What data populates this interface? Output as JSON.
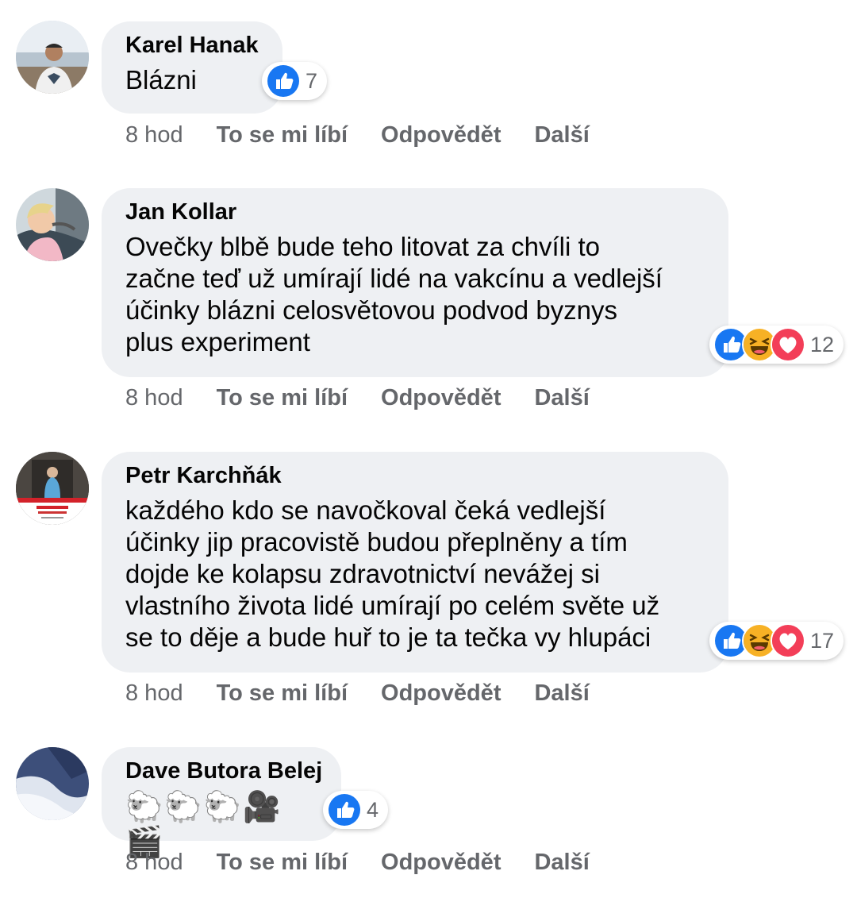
{
  "actions": {
    "like": "To se mi líbí",
    "reply": "Odpovědět",
    "more": "Další"
  },
  "colors": {
    "bubble": "#eef0f3",
    "secondary_text": "#65676b",
    "like_blue": "#1877f2",
    "haha_yellow": "#f7b125",
    "love_red": "#f33e58"
  },
  "comments": [
    {
      "author": "Karel Hanak",
      "text_lines": [
        "Blázni"
      ],
      "reactions": [
        "like-icon"
      ],
      "reaction_count": "7",
      "time": "8 hod"
    },
    {
      "author": "Jan Kollar",
      "text_lines": [
        "Ovečky blbě bude teho litovat za chvíli to",
        "začne teď už umírají lidé na vakcínu a vedlejší",
        "účinky blázni celosvětovou podvod byznys",
        "plus experiment"
      ],
      "reactions": [
        "like-icon",
        "haha-icon",
        "love-icon"
      ],
      "reaction_count": "12",
      "time": "8 hod"
    },
    {
      "author": "Petr Karchňák",
      "text_lines": [
        "každého kdo se navočkoval čeká vedlejší",
        "účinky jip pracovistě budou přeplněny a tím",
        "dojde ke kolapsu zdravotnictví nevážej si",
        "vlastního života lidé umírají po celém světe už",
        "se to děje a bude huř to je ta tečka vy hlupáci"
      ],
      "reactions": [
        "like-icon",
        "haha-icon",
        "love-icon"
      ],
      "reaction_count": "17",
      "time": "8 hod"
    },
    {
      "author": "Dave Butora Belej",
      "emojis": [
        "🐑",
        "🐑",
        "🐑",
        "🎥",
        "🎬"
      ],
      "reactions": [
        "like-icon"
      ],
      "reaction_count": "4",
      "time": "8 hod"
    }
  ]
}
